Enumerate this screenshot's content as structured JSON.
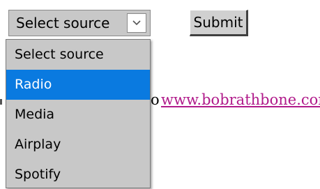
{
  "form": {
    "select": {
      "selected_label": "Select source",
      "arrow_icon": "chevron-down-icon"
    },
    "submit_label": "Submit"
  },
  "dropdown": {
    "options": [
      {
        "label": "Select source",
        "selected": false
      },
      {
        "label": "Radio",
        "selected": true
      },
      {
        "label": "Media",
        "selected": false
      },
      {
        "label": "Airplay",
        "selected": false
      },
      {
        "label": "Spotify",
        "selected": false
      }
    ],
    "highlight_color": "#0a7ae0"
  },
  "page": {
    "partial_text": "o",
    "link_text": "www.bobrathbone.com",
    "link_color": "#b01a8a"
  }
}
